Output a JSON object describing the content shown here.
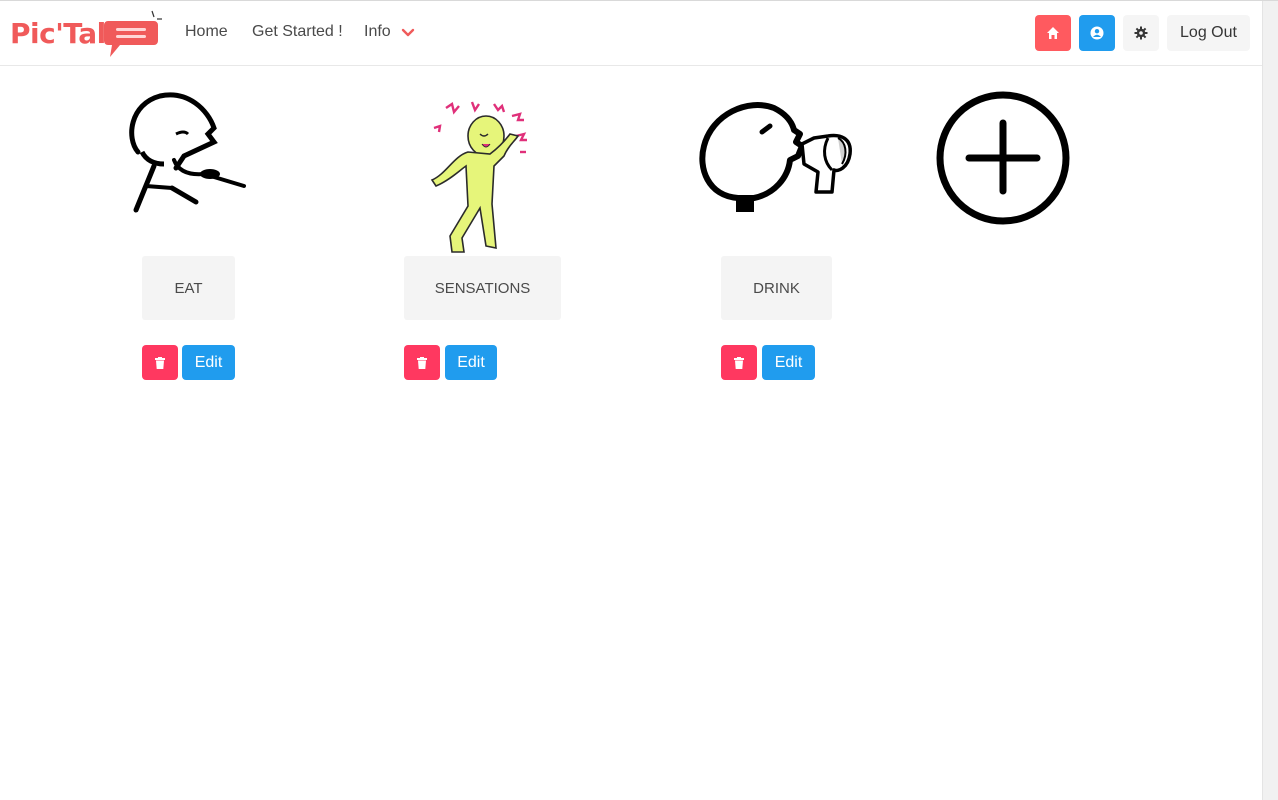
{
  "app": {
    "logo_text": "Pic'Talk"
  },
  "nav": {
    "home": "Home",
    "get_started": "Get Started !",
    "info": "Info",
    "logout": "Log Out"
  },
  "colors": {
    "brand": "#f05a5a",
    "danger": "#ff3860",
    "info": "#209cee",
    "home": "#ff5a5f"
  },
  "pictograms": [
    {
      "label": "EAT",
      "icon": "eat-pictogram",
      "edit": "Edit"
    },
    {
      "label": "SENSATIONS",
      "icon": "sensations-pictogram",
      "edit": "Edit"
    },
    {
      "label": "DRINK",
      "icon": "drink-pictogram",
      "edit": "Edit"
    }
  ],
  "add_button": {
    "icon": "plus-circle-icon"
  }
}
